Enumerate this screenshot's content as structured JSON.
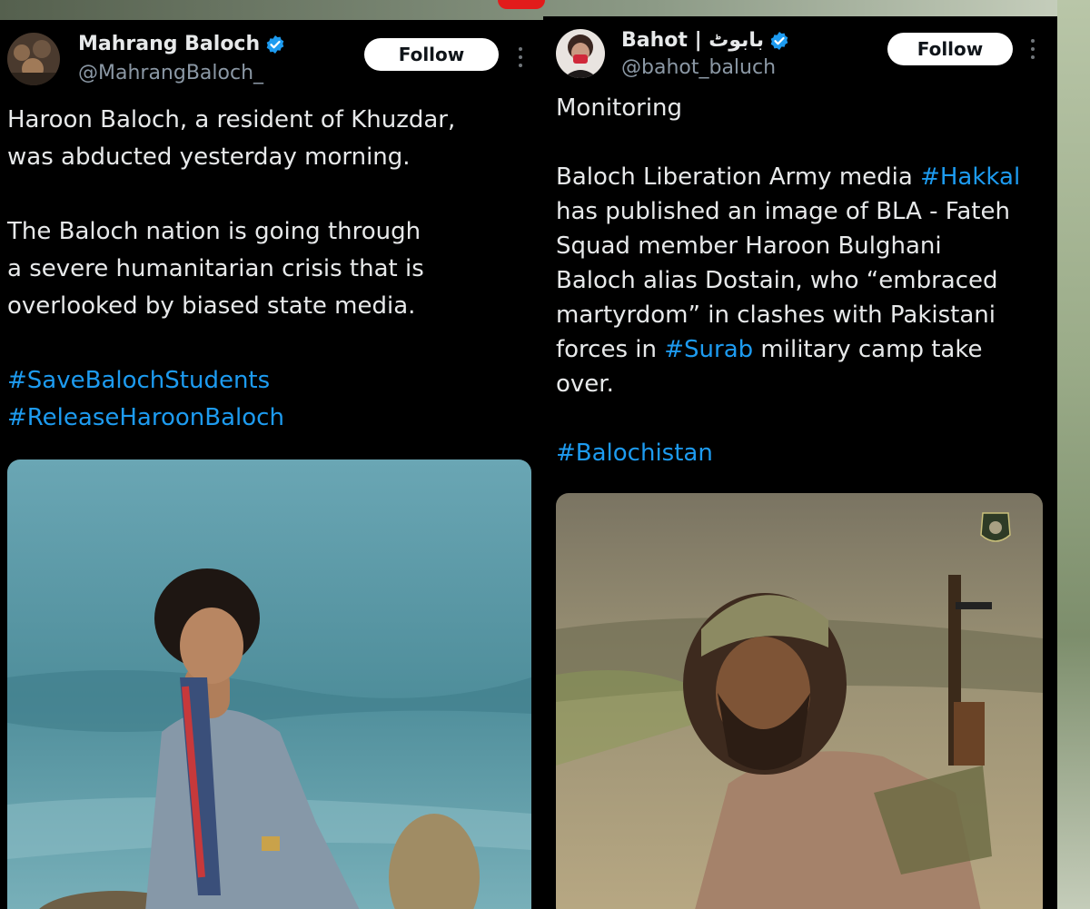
{
  "left_post": {
    "author_name": "Mahrang Baloch",
    "handle": "@MahrangBaloch_",
    "follow_label": "Follow",
    "line1": "Haroon Baloch, a resident of Khuzdar,",
    "line2": "was abducted yesterday morning.",
    "line3": "The Baloch nation is going through",
    "line4": "a severe humanitarian crisis that is",
    "line5": "overlooked by biased state media.",
    "hashtag1": "#SaveBalochStudents",
    "hashtag2": "#ReleaseHaroonBaloch"
  },
  "right_post": {
    "author_name": "Bahot | بابوٹ",
    "handle": "@bahot_baluch",
    "follow_label": "Follow",
    "line1": "Monitoring",
    "line2_a": "Baloch Liberation Army media ",
    "line2_tag": "#Hakkal",
    "line3": "has published an image of BLA - Fateh",
    "line4": "Squad member Haroon Bulghani",
    "line5": "Baloch alias Dostain, who “embraced",
    "line6": "martyrdom” in clashes with Pakistani",
    "line7_a": "forces in ",
    "line7_tag": "#Surab",
    "line7_b": " military camp take",
    "line8": "over.",
    "hashtag": "#Balochistan"
  },
  "colors": {
    "background": "#000000",
    "text": "#e7e9ea",
    "secondary": "#8b98a5",
    "link": "#1d9bf0",
    "verified": "#1d9bf0"
  }
}
